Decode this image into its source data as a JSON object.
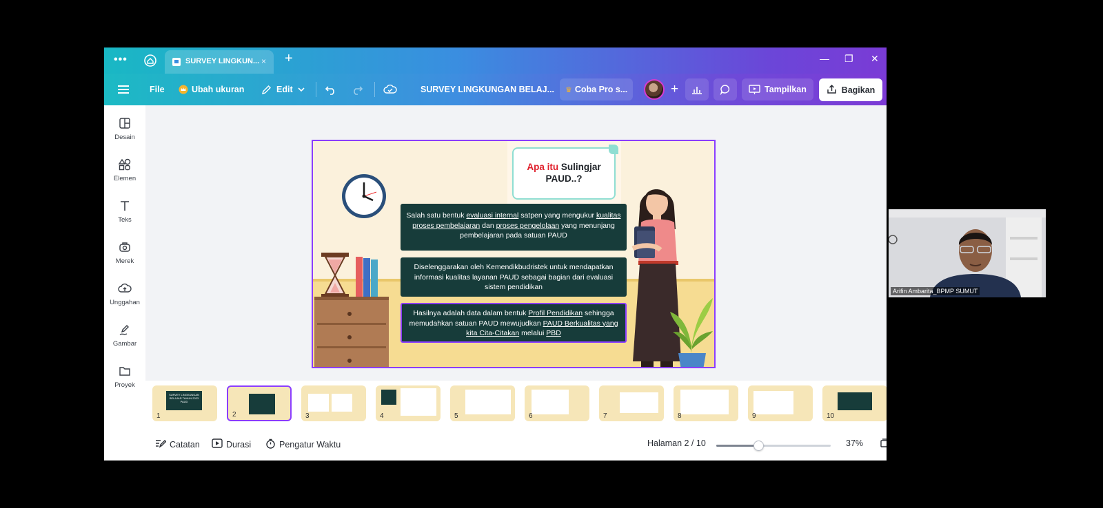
{
  "tabbar": {
    "more_label": "•••",
    "tab_title": "SURVEY LINGKUN...",
    "tab_close": "×",
    "new_tab": "+",
    "minimize": "—",
    "restore": "❐",
    "close": "✕"
  },
  "toolbar": {
    "file_label": "File",
    "resize_label": "Ubah ukuran",
    "edit_label": "Edit",
    "doc_title": "SURVEY LINGKUNGAN BELAJ...",
    "pro_label": "Coba Pro s...",
    "add_label": "+",
    "present_label": "Tampilkan",
    "share_label": "Bagikan"
  },
  "sidebar": {
    "items": [
      {
        "label": "Desain",
        "icon": "layout-icon"
      },
      {
        "label": "Elemen",
        "icon": "shapes-icon"
      },
      {
        "label": "Teks",
        "icon": "text-icon"
      },
      {
        "label": "Merek",
        "icon": "brand-icon"
      },
      {
        "label": "Unggahan",
        "icon": "upload-cloud-icon"
      },
      {
        "label": "Gambar",
        "icon": "draw-icon"
      },
      {
        "label": "Proyek",
        "icon": "folder-icon"
      }
    ]
  },
  "slide": {
    "title_red": "Apa itu",
    "title_black": "Sulingjar",
    "title_line2": "PAUD..?",
    "box1": {
      "t1": "Salah satu bentuk ",
      "u1": "evaluasi internal",
      "t2": " satpen yang mengukur ",
      "u2": "kualitas proses pembelajaran",
      "t3": " dan ",
      "u3": "proses pengelolaan",
      "t4": " yang menunjang pembelajaran pada satuan PAUD"
    },
    "box2": {
      "text": "Diselenggarakan oleh Kemendikbudristek untuk mendapatkan informasi kualitas layanan PAUD sebagai bagian dari evaluasi sistem pendidikan"
    },
    "box3": {
      "t1": "Hasilnya adalah data dalam bentuk ",
      "u1": "Profil Pendidikan",
      "t2": " sehingga memudahkan satuan PAUD mewujudkan ",
      "u2": "PAUD Berkualitas yang kita Cita-Citakan",
      "t3": " melalui ",
      "u3": "PBD"
    }
  },
  "thumbnails": [
    "1",
    "2",
    "3",
    "4",
    "5",
    "6",
    "7",
    "8",
    "9",
    "10"
  ],
  "thumb1_text": "SURVEY LINGKUNGAN BELAJAR TAHUN 2023 PAUD",
  "footer": {
    "notes_label": "Catatan",
    "duration_label": "Durasi",
    "timer_label": "Pengatur Waktu",
    "page_label": "Halaman 2 / 10",
    "zoom_label": "37%",
    "zoom_fraction": 0.37
  },
  "webcam": {
    "participant": "Arifin Ambarita_BPMP SUMUT"
  },
  "colors": {
    "accent": "#8b3dff",
    "slide_box": "#173c3a",
    "title_red": "#e01f2b"
  }
}
